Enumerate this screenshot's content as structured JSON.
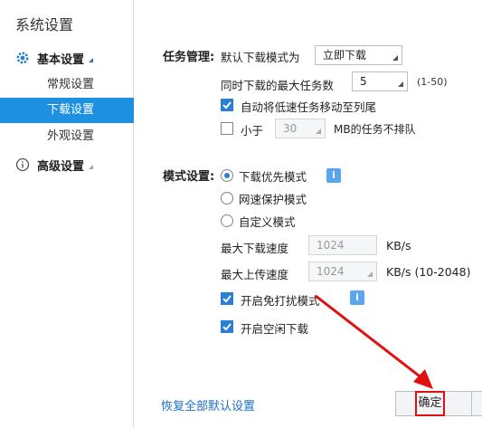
{
  "sidebar": {
    "title": "系统设置",
    "groups": [
      {
        "label": "基本设置",
        "items": [
          "常规设置",
          "下载设置",
          "外观设置"
        ],
        "active_index": 1
      },
      {
        "label": "高级设置",
        "items": []
      }
    ]
  },
  "task": {
    "section_label": "任务管理:",
    "mode_label": "默认下载模式为",
    "mode_value": "立即下载",
    "max_tasks_label": "同时下载的最大任务数",
    "max_tasks_value": "5",
    "max_tasks_hint": "(1-50)",
    "move_slow_label": "自动将低速任务移动至列尾",
    "move_slow_checked": true,
    "less_than_label": "小于",
    "less_than_value": "30",
    "less_than_suffix": "MB的任务不排队",
    "less_than_checked": false
  },
  "mode": {
    "section_label": "模式设置:",
    "options": [
      "下载优先模式",
      "网速保护模式",
      "自定义模式"
    ],
    "selected_index": 0,
    "max_download_label": "最大下载速度",
    "max_download_value": "1024",
    "max_download_unit": "KB/s",
    "max_upload_label": "最大上传速度",
    "max_upload_value": "1024",
    "max_upload_unit": "KB/s (10-2048)",
    "no_disturb_label": "开启免打扰模式",
    "no_disturb_checked": true,
    "idle_download_label": "开启空闲下载",
    "idle_download_checked": true
  },
  "footer": {
    "restore_label": "恢复全部默认设置",
    "ok_label": "确定"
  },
  "colors": {
    "accent": "#1e90e0",
    "annotation_red": "#e10f0f"
  }
}
